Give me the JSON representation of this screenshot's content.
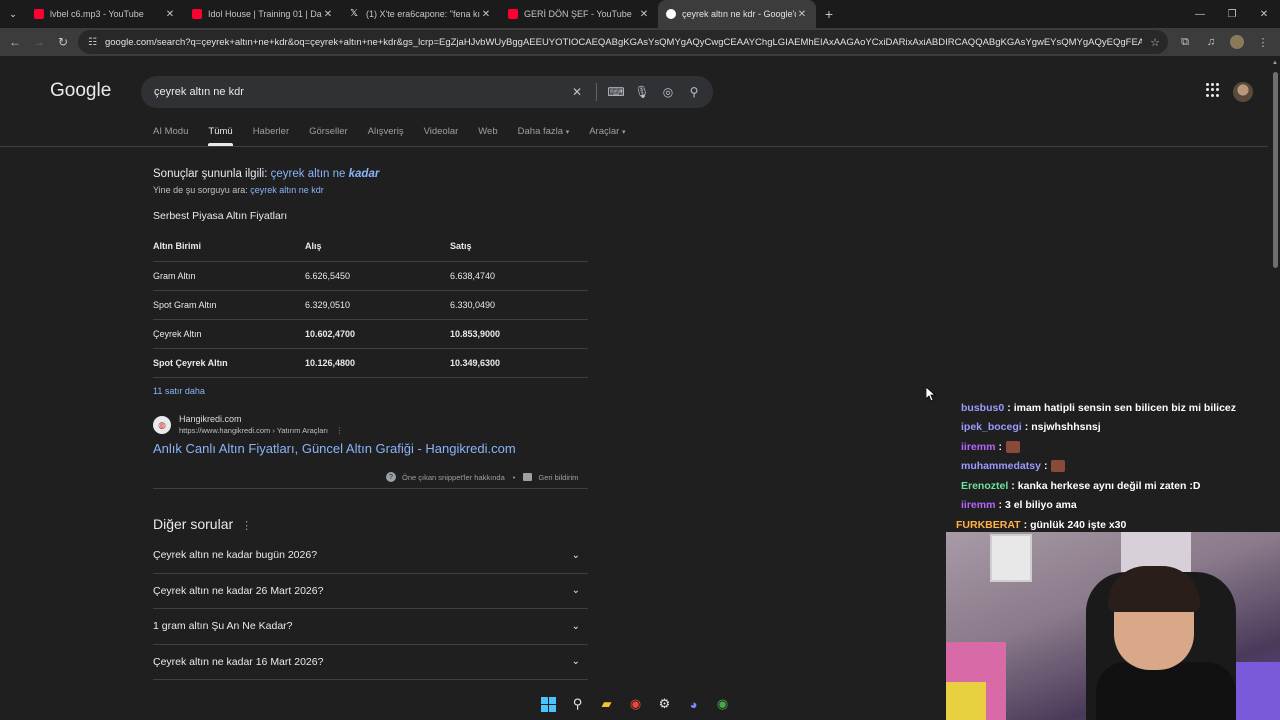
{
  "browser": {
    "tabs": [
      {
        "title": "lvbel c6.mp3 - YouTube",
        "favicon_color": "#ff0033"
      },
      {
        "title": "Idol House | Training 01 | Dans",
        "favicon_color": "#ff0033"
      },
      {
        "title": "(1) X'te era6capone: \"fena kıska",
        "favicon_color": "#e8e8e8"
      },
      {
        "title": "GERİ DÖN ŞEF - YouTube",
        "favicon_color": "#ff0033"
      },
      {
        "title": "çeyrek altın ne kdr - Google'da",
        "favicon_color": "#4285f4",
        "active": true
      }
    ],
    "url": "google.com/search?q=çeyrek+altın+ne+kdr&oq=çeyrek+altın+ne+kdr&gs_lcrp=EgZjaHJvbWUyBggAEEUYOTIOCAEQABgKGAsYsQMYgAQyCwgCEAAYChgLGIAEMhEIAxAAGAoYCxiDARixAxiABDIRCAQQABgKGAsYgwEYsQMYgAQyEQgFEAAYChgLGIM..."
  },
  "google": {
    "logo": "Google",
    "query": "çeyrek altın ne kdr",
    "nav_tabs": [
      "AI Modu",
      "Tümü",
      "Haberler",
      "Görseller",
      "Alışveriş",
      "Videolar",
      "Web",
      "Daha fazla",
      "Araçlar"
    ],
    "active_tab": "Tümü",
    "correction": {
      "prefix": "Sonuçlar şununla ilgili:",
      "corrected_plain": "çeyrek altın ne",
      "corrected_bold": "kadar",
      "original_prefix": "Yine de şu sorguyu ara:",
      "original_query": "çeyrek altın ne kdr"
    },
    "snippet": {
      "title": "Serbest Piyasa Altın Fiyatları",
      "headers": [
        "Altın Birimi",
        "Alış",
        "Satış"
      ],
      "rows": [
        {
          "name": "Gram Altın",
          "buy": "6.626,5450",
          "sell": "6.638,4740",
          "bold": false
        },
        {
          "name": "Spot Gram Altın",
          "buy": "6.329,0510",
          "sell": "6.330,0490",
          "bold": false
        },
        {
          "name": "Çeyrek Altın",
          "buy": "10.602,4700",
          "sell": "10.853,9000",
          "bold": "values"
        },
        {
          "name": "Spot Çeyrek Altın",
          "buy": "10.126,4800",
          "sell": "10.349,6300",
          "bold": "all"
        }
      ],
      "more_rows": "11 satır daha",
      "source_name": "Hangikredi.com",
      "source_url": "https://www.hangikredi.com › Yatırım Araçları",
      "result_title": "Anlık Canlı Altın Fiyatları, Güncel Altın Grafiği - Hangikredi.com",
      "about_label": "Öne çıkan snippet'ler hakkında",
      "feedback_label": "Geri bildirim"
    },
    "paa": {
      "title": "Diğer sorular",
      "items": [
        "Çeyrek altın ne kadar bugün 2026?",
        "Çeyrek altın ne kadar 26 Mart 2026?",
        "1 gram altın Şu An Ne Kadar?",
        "Çeyrek altın ne kadar 16 Mart 2026?"
      ]
    }
  },
  "stream_chat": [
    {
      "user": "busbus0",
      "color": "#9b9bff",
      "text": "imam hatipli sensin sen bilicen biz mi bilicez"
    },
    {
      "user": "ipek_bocegi",
      "color": "#9b9bff",
      "text": "nsjwhshhsnsj"
    },
    {
      "user": "iiremm",
      "color": "#b565ff",
      "text": "",
      "emote": true
    },
    {
      "user": "muhammedatsy",
      "color": "#9b9bff",
      "text": "",
      "emote": true
    },
    {
      "user": "Erenoztel",
      "color": "#6ee0a0",
      "text": "kanka herkese aynı değil mi zaten :D"
    },
    {
      "user": "iiremm",
      "color": "#b565ff",
      "text": "3 el biliyo ama"
    },
    {
      "user": "FURKBERAT",
      "color": "#ffb347",
      "text": "günlük 240 işte x30"
    }
  ]
}
